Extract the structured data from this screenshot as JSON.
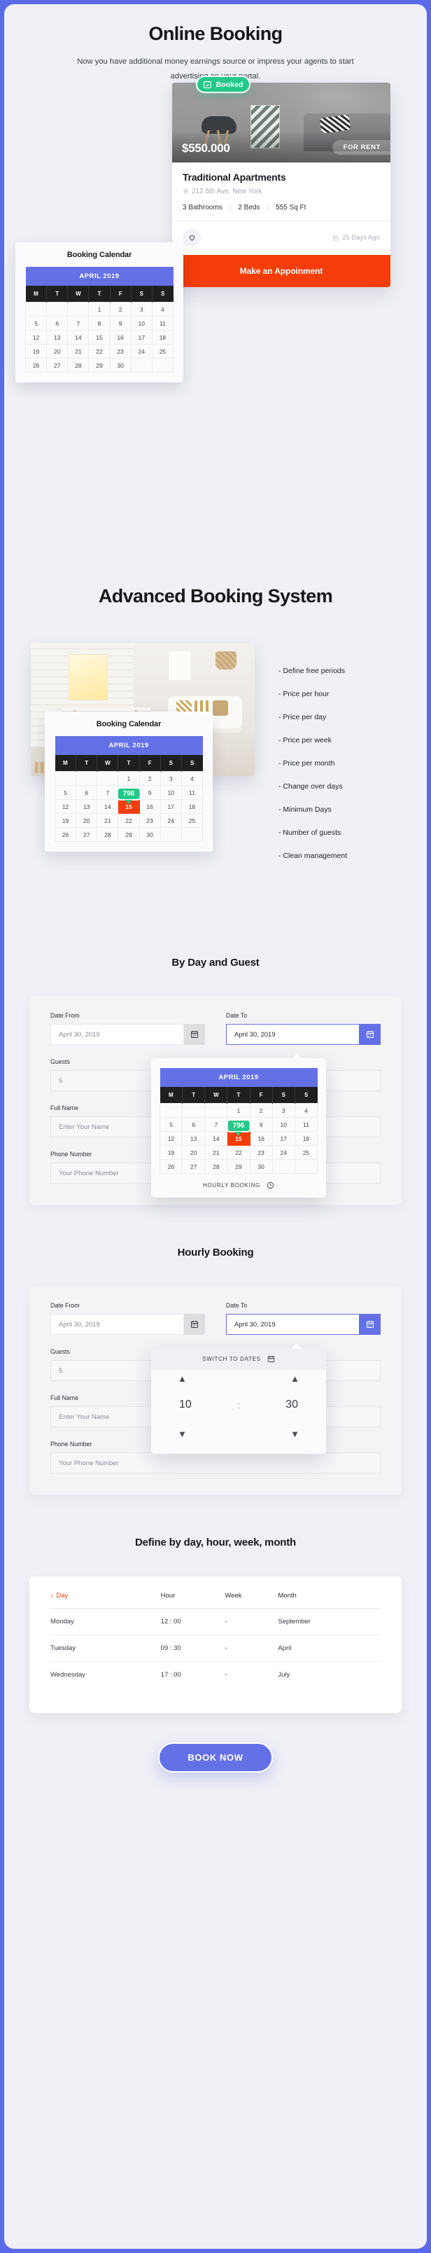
{
  "hero": {
    "title": "Online Booking",
    "subtitle": "Now you have additional money earnings source or impress your agents to start advertising on your portal.",
    "badge": {
      "label": "Booked",
      "icon": "calendar-check-icon",
      "color": "#24c98a"
    },
    "property": {
      "price": "$550.000",
      "status_tag": "FOR RENT",
      "title": "Traditional Apartments",
      "address": "212 5th Ave, New York",
      "address_icon": "map-pin-icon",
      "specs": [
        "3 Bathrooms",
        "2 Beds",
        "555 Sq Ft"
      ],
      "favorite_icon": "heart-icon",
      "posted": "25 Days Ago",
      "posted_icon": "calendar-icon",
      "cta": "Make an Appoinment",
      "cta_color": "#f43d09"
    }
  },
  "calendar": {
    "card_title": "Booking Calendar",
    "month": "APRIL 2019",
    "dow": [
      "M",
      "T",
      "W",
      "T",
      "F",
      "S",
      "S"
    ],
    "weeks": [
      [
        "",
        "",
        "",
        "1",
        "2",
        "3",
        "4"
      ],
      [
        "5",
        "6",
        "7",
        "8",
        "9",
        "10",
        "11"
      ],
      [
        "12",
        "13",
        "14",
        "15",
        "16",
        "17",
        "18"
      ],
      [
        "19",
        "20",
        "21",
        "22",
        "23",
        "24",
        "25"
      ],
      [
        "26",
        "27",
        "28",
        "29",
        "30",
        "",
        ""
      ]
    ],
    "selected_day": "15",
    "price_bubble": "796",
    "header_color": "#6471e6",
    "selected_color": "#f43d09",
    "bubble_color": "#24c98a"
  },
  "advanced": {
    "title": "Advanced Booking System",
    "features": [
      "- Define free periods",
      "- Price per hour",
      "- Price per day",
      "- Price per week",
      "- Price per month",
      "- Change over days",
      "- Minimum Days",
      "- Number of guests",
      "- Clean management"
    ]
  },
  "by_day_guest": {
    "title": "By Day and Guest",
    "date_from": {
      "label": "Date From",
      "value": "April 30, 2019",
      "icon": "calendar-icon"
    },
    "date_to": {
      "label": "Date To",
      "value": "April 30, 2019",
      "icon": "calendar-icon"
    },
    "guests": {
      "label": "Guests",
      "value": "5"
    },
    "full_name": {
      "label": "Full Name",
      "placeholder": "Enter Your Name"
    },
    "phone": {
      "label": "Phone Number",
      "placeholder": "Your Phone Number"
    },
    "popover_footer": "HOURLY BOOKING",
    "popover_footer_icon": "clock-icon"
  },
  "hourly": {
    "title": "Hourly Booking",
    "date_from": {
      "label": "Date From",
      "value": "April 30, 2019",
      "icon": "calendar-icon"
    },
    "date_to": {
      "label": "Date To",
      "value": "April 30, 2019",
      "icon": "calendar-icon"
    },
    "guests": {
      "label": "Guests",
      "value": "5"
    },
    "full_name": {
      "label": "Full Name",
      "placeholder": "Enter Your Name"
    },
    "phone": {
      "label": "Phone Number",
      "placeholder": "Your Phone Number"
    },
    "popover_header": "SWITCH TO DATES",
    "popover_header_icon": "calendar-icon",
    "time": {
      "hour": "10",
      "separator": ":",
      "minute": "30"
    },
    "up_icon": "chevron-up-icon",
    "down_icon": "chevron-down-icon"
  },
  "define_table": {
    "title": "Define by day, hour, week, month",
    "columns": [
      "Day",
      "Hour",
      "Week",
      "Month"
    ],
    "sorted_column": "Day",
    "sort_icon": "arrow-down-icon",
    "rows": [
      [
        "Monday",
        "12 : 00",
        "-",
        "September"
      ],
      [
        "Tuesday",
        "09 : 30",
        "-",
        "April"
      ],
      [
        "Wednesday",
        "17 : 00",
        "-",
        "July"
      ]
    ]
  },
  "cta": {
    "label": "BOOK NOW",
    "color": "#6471e6"
  }
}
